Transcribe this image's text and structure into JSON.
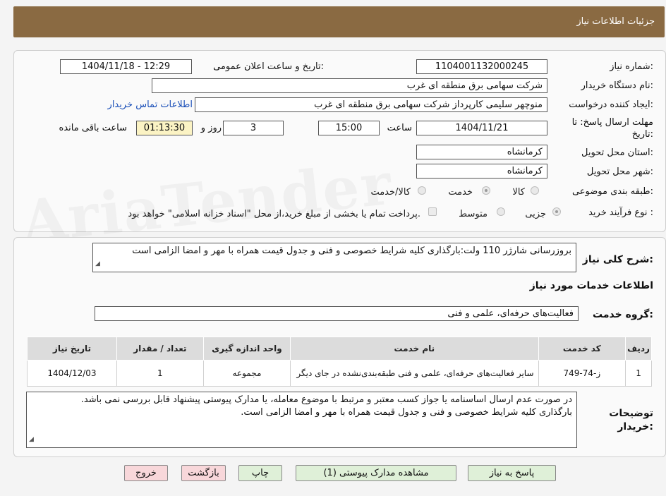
{
  "header": {
    "title": "جزئیات اطلاعات نیاز"
  },
  "form": {
    "need_number_label": "شماره نیاز:",
    "need_number": "1104001132000245",
    "announce_label": "تاریخ و ساعت اعلان عمومی:",
    "announce_value": "1404/11/18 - 12:29",
    "buyer_org_label": "نام دستگاه خریدار:",
    "buyer_org": "شرکت سهامی برق منطقه ای غرب",
    "requester_label": "ایجاد کننده درخواست:",
    "requester": "منوچهر  سلیمی کارپرداز شرکت سهامی برق منطقه ای غرب",
    "contact_link": "اطلاعات تماس خریدار",
    "deadline_label_1": "مهلت ارسال پاسخ: تا",
    "deadline_label_2": "تاریخ:",
    "deadline_date": "1404/11/21",
    "time_label": "ساعت",
    "deadline_time": "15:00",
    "days": "3",
    "days_label": "روز و",
    "remaining_time": "01:13:30",
    "remaining_label": "ساعت باقی مانده",
    "province_label": "استان محل تحویل:",
    "province": "کرمانشاه",
    "city_label": "شهر محل تحویل:",
    "city": "کرمانشاه",
    "category_label": "طبقه بندی موضوعی:",
    "category_options": [
      "کالا",
      "خدمت",
      "کالا/خدمت"
    ],
    "category_selected": "خدمت",
    "process_label": "نوع فرآیند خرید :",
    "process_options": [
      "جزیی",
      "متوسط"
    ],
    "process_selected": "جزیی",
    "payment_note": "پرداخت تمام یا بخشی از مبلغ خرید،از محل \"اسناد خزانه اسلامی\" خواهد بود."
  },
  "description": {
    "label": "شرح کلی نیاز:",
    "text": "بروزرسانی شارژر 110 ولت:بارگذاری کلیه شرایط خصوصی و فنی و جدول قیمت همراه با مهر و امضا الزامی است"
  },
  "services": {
    "section_title": "اطلاعات خدمات مورد نیاز",
    "group_label": "گروه خدمت:",
    "group_value": "فعالیت‌های حرفه‌ای، علمی و فنی",
    "columns": [
      "ردیف",
      "کد خدمت",
      "نام خدمت",
      "واحد اندازه گیری",
      "تعداد / مقدار",
      "تاریخ نیاز"
    ],
    "rows": [
      {
        "index": "1",
        "code": "ز-74-749",
        "name": "سایر فعالیت‌های حرفه‌ای، علمی و فنی طبقه‌بندی‌نشده در جای دیگر",
        "unit": "مجموعه",
        "qty": "1",
        "date": "1404/12/03"
      }
    ]
  },
  "buyer_notes": {
    "label_1": "توضیحات",
    "label_2": "خریدار:",
    "line1": "در صورت عدم ارسال اساسنامه یا جواز کسب معتبر و مرتبط با موضوع معامله،  یا مدارک پیوستی پیشنهاد قابل بررسی نمی باشد.",
    "line2": "بارگذاری کلیه شرایط خصوصی و فنی و جدول قیمت همراه با مهر و امضا الزامی است."
  },
  "buttons": {
    "respond": "پاسخ به نیاز",
    "attachments": "مشاهده مدارک پیوستی (1)",
    "print": "چاپ",
    "back": "بازگشت",
    "exit": "خروج"
  },
  "colors": {
    "header": "#8a6a42",
    "green_button": "#dff0d8",
    "pink_button": "#f8d7da",
    "highlight": "#fbf3c4"
  }
}
